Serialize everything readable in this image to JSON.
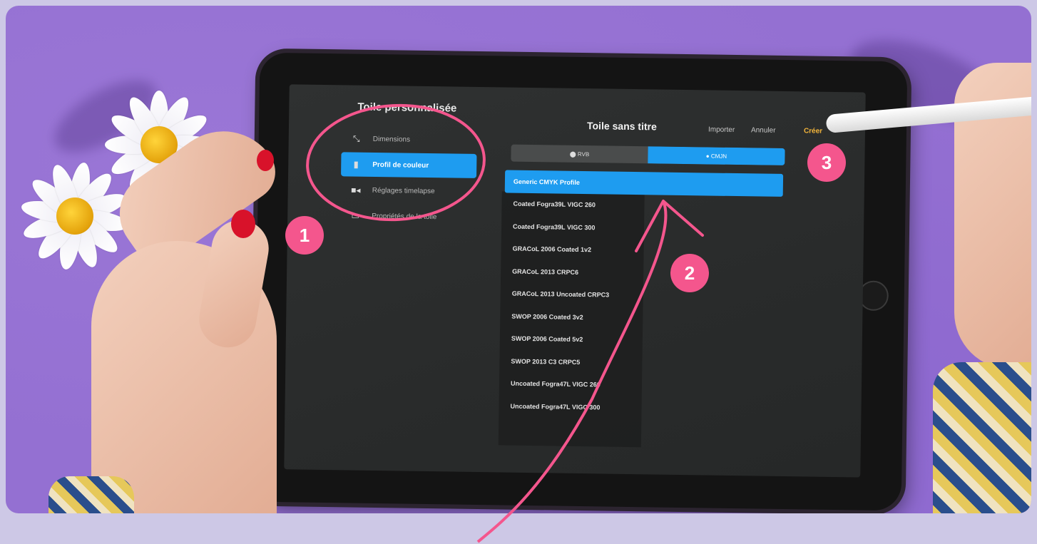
{
  "sidebar": {
    "title": "Toile personnalisée",
    "items": [
      {
        "label": "Dimensions",
        "icon": "resize-icon",
        "active": false
      },
      {
        "label": "Profil de couleur",
        "icon": "document-icon",
        "active": true
      },
      {
        "label": "Réglages timelapse",
        "icon": "camera-icon",
        "active": false
      },
      {
        "label": "Propriétés de la toile",
        "icon": "canvas-icon",
        "active": false
      }
    ]
  },
  "header": {
    "title": "Toile sans titre",
    "import_label": "Importer",
    "cancel_label": "Annuler",
    "create_label": "Créer"
  },
  "color_mode": {
    "options": [
      {
        "label": "RVB",
        "selected": false
      },
      {
        "label": "CMJN",
        "selected": true
      }
    ]
  },
  "profiles": [
    {
      "label": "Generic CMYK Profile",
      "selected": true
    },
    {
      "label": "Coated Fogra39L VIGC 260"
    },
    {
      "label": "Coated Fogra39L VIGC 300"
    },
    {
      "label": "GRACoL 2006 Coated 1v2"
    },
    {
      "label": "GRACoL 2013 CRPC6"
    },
    {
      "label": "GRACoL 2013 Uncoated CRPC3"
    },
    {
      "label": "SWOP 2006 Coated 3v2"
    },
    {
      "label": "SWOP 2006 Coated 5v2"
    },
    {
      "label": "SWOP 2013 C3 CRPC5"
    },
    {
      "label": "Uncoated Fogra47L VIGC 260"
    },
    {
      "label": "Uncoated Fogra47L VIGC 300"
    }
  ],
  "annotations": {
    "step1": "1",
    "step2": "2",
    "step3": "3",
    "color": "#f4568d"
  },
  "colors": {
    "accent": "#1e9cf0",
    "create": "#f5b63b",
    "background": "#9470d2"
  }
}
